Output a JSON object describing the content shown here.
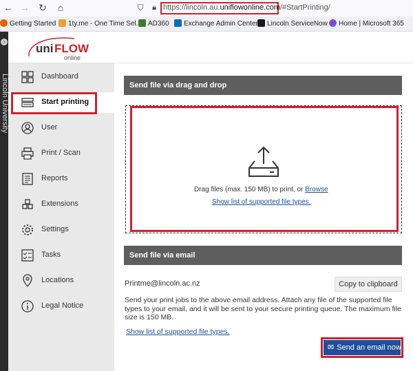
{
  "browser": {
    "url_prefix": "https://lincoln.au.",
    "url_domain": "uniflowonline.com",
    "url_suffix": "/#StartPrinting/",
    "bookmarks": [
      "Getting Started",
      "1ty.me - One Time Sel...",
      "AD360",
      "Exchange Admin Center",
      "Lincoln ServiceNow",
      "Home | Microsoft 365"
    ]
  },
  "side_strip": {
    "text": "Lincoln University"
  },
  "logo": {
    "uni": "uni",
    "flow": "FLOW",
    "online": "online"
  },
  "sidebar": {
    "items": [
      {
        "label": "Dashboard",
        "icon": "dashboard-icon"
      },
      {
        "label": "Start printing",
        "icon": "printer-tray-icon",
        "active": true
      },
      {
        "label": "User",
        "icon": "user-icon"
      },
      {
        "label": "Print / Scan",
        "icon": "printer-icon"
      },
      {
        "label": "Reports",
        "icon": "reports-icon"
      },
      {
        "label": "Extensions",
        "icon": "extensions-icon"
      },
      {
        "label": "Settings",
        "icon": "gear-icon"
      },
      {
        "label": "Tasks",
        "icon": "tasks-icon"
      },
      {
        "label": "Locations",
        "icon": "location-icon"
      },
      {
        "label": "Legal Notice",
        "icon": "info-icon"
      }
    ]
  },
  "dragdrop": {
    "header": "Send file via drag and drop",
    "drag_text": "Drag files (max. 150 MB) to print, or ",
    "browse_link": "Browse",
    "filetypes_link": "Show list of supported file types."
  },
  "email": {
    "header": "Send file via email",
    "address": "Printme@lincoln.ac.nz",
    "copy_button": "Copy to clipboard",
    "description": "Send your print jobs to the above email address. Attach any file of the supported file types to your email, and it will be sent to your secure printing queue. The maximum file size is 150 MB.",
    "filetypes_link": "Show list of supported file types.",
    "send_button": "Send an email now"
  },
  "colors": {
    "accent": "#d0212d",
    "header_bar": "#5e5e5e",
    "button": "#1f4e9a",
    "sidebar": "#e9e9e9"
  }
}
